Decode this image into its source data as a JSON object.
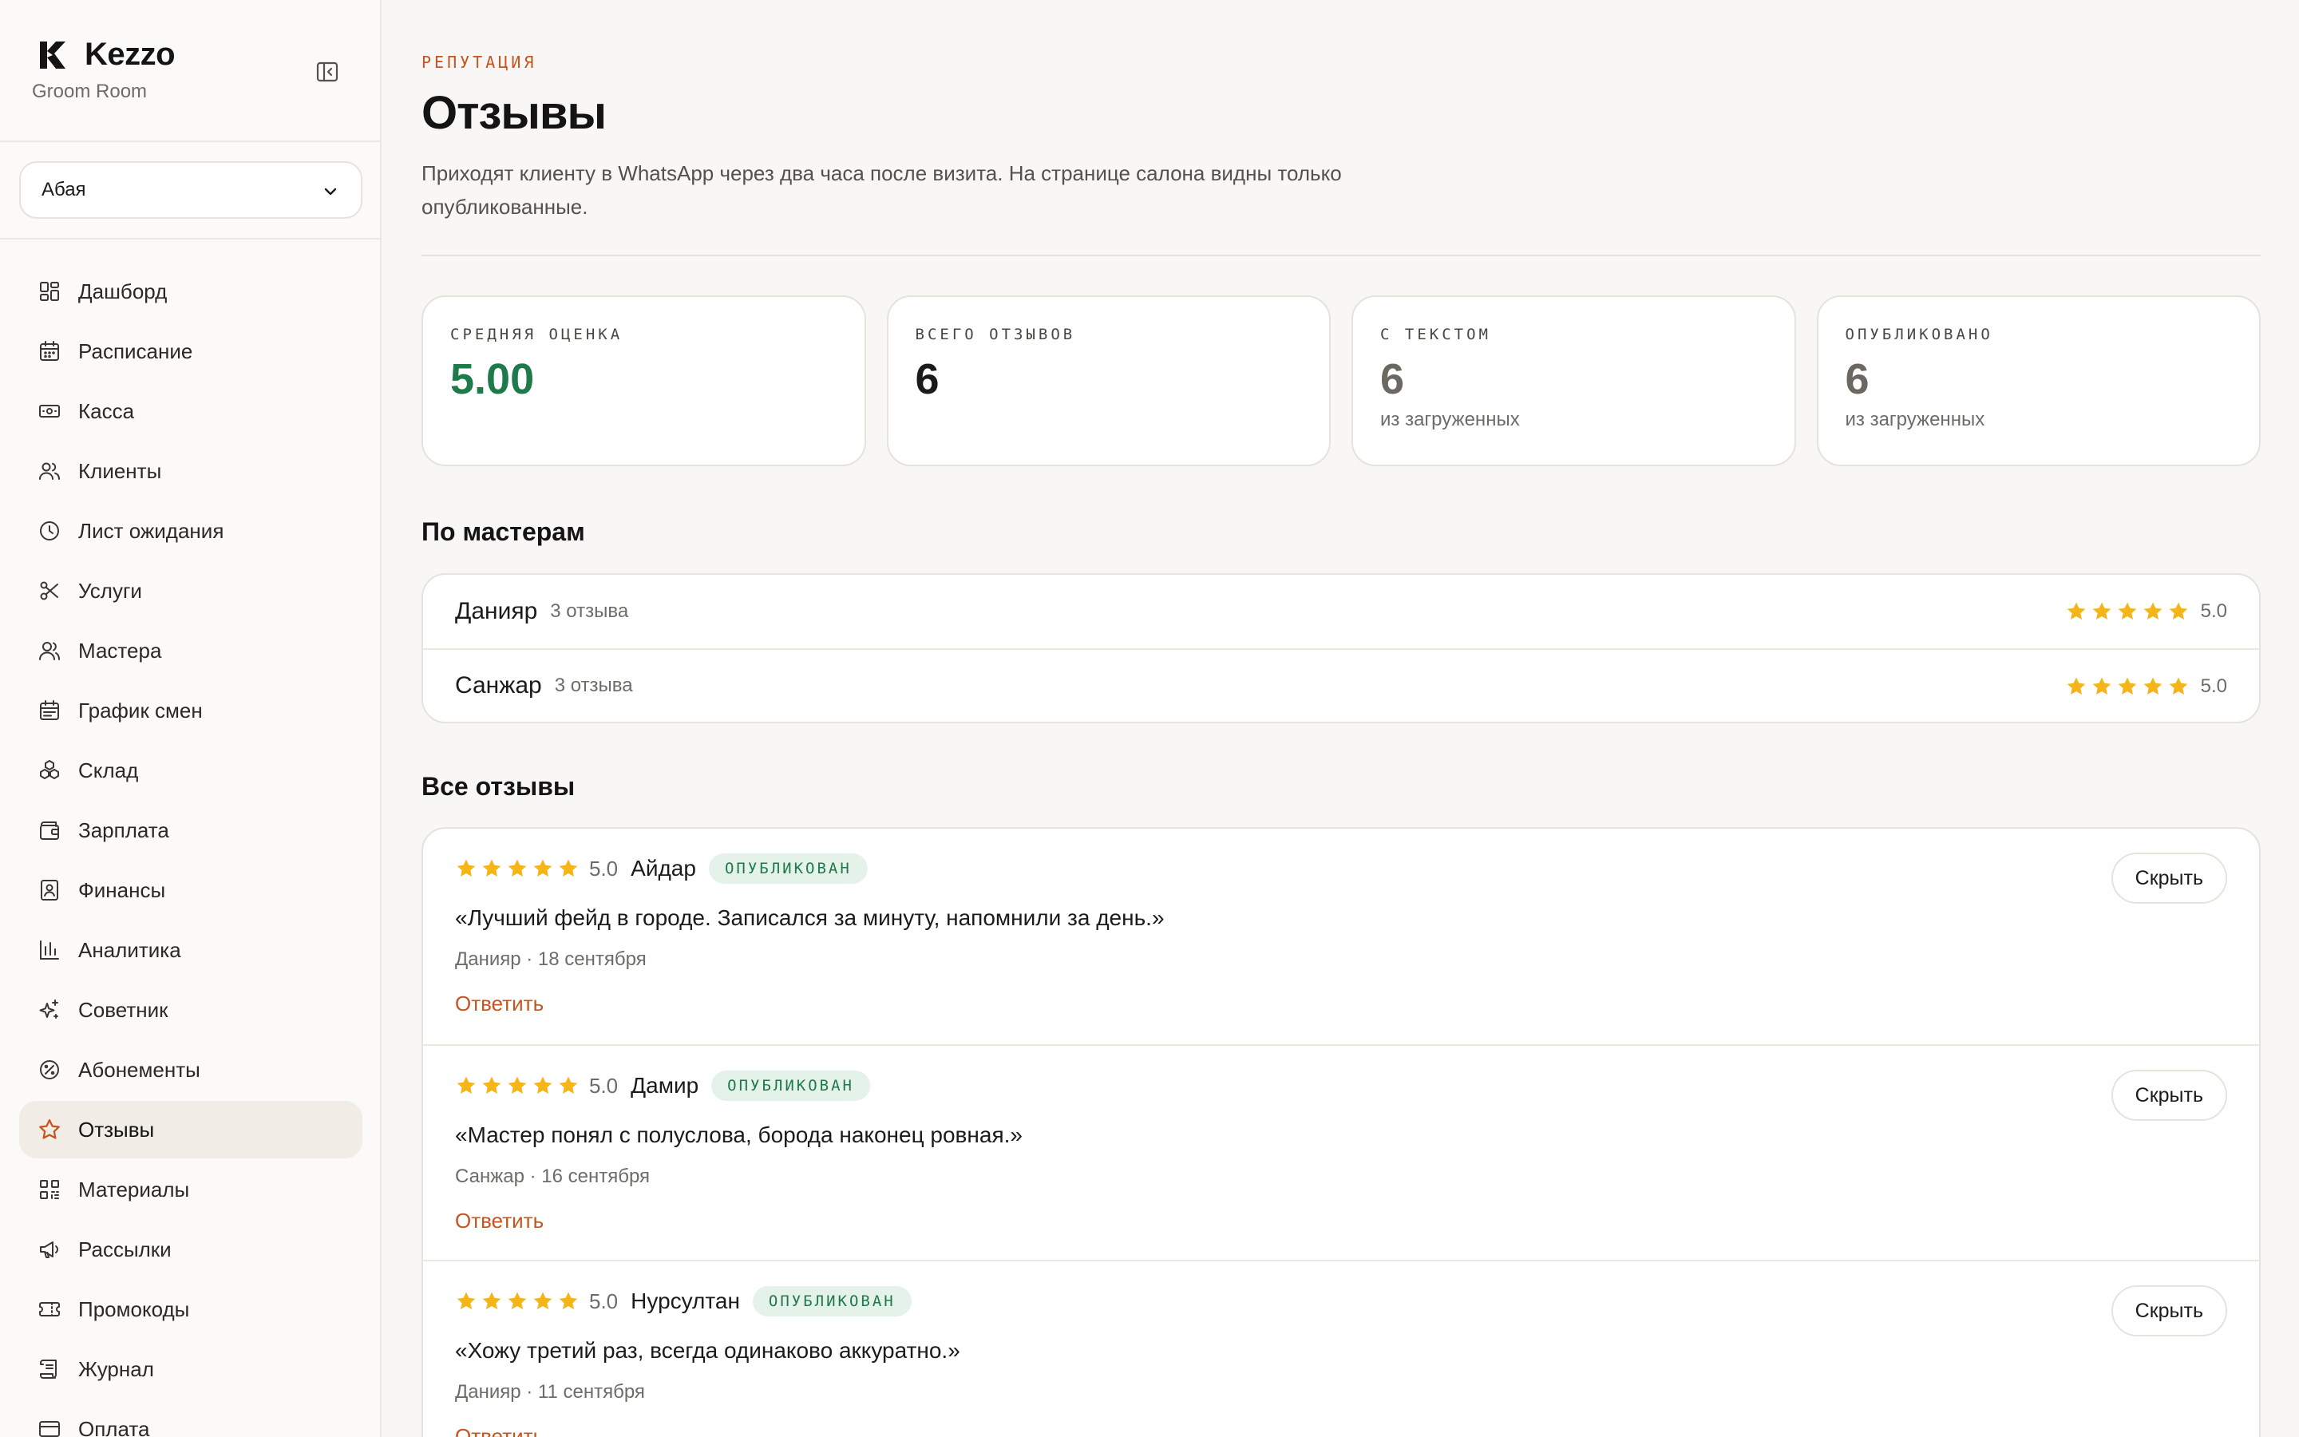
{
  "brand": {
    "name": "Kezzo",
    "subtitle": "Groom Room"
  },
  "branch": {
    "selected": "Абая"
  },
  "nav": [
    {
      "label": "Дашборд",
      "icon": "dashboard-icon"
    },
    {
      "label": "Расписание",
      "icon": "calendar-icon"
    },
    {
      "label": "Касса",
      "icon": "cash-icon"
    },
    {
      "label": "Клиенты",
      "icon": "users-icon"
    },
    {
      "label": "Лист ожидания",
      "icon": "clock-icon"
    },
    {
      "label": "Услуги",
      "icon": "scissors-icon"
    },
    {
      "label": "Мастера",
      "icon": "masters-icon"
    },
    {
      "label": "График смен",
      "icon": "shift-calendar-icon"
    },
    {
      "label": "Склад",
      "icon": "boxes-icon"
    },
    {
      "label": "Зарплата",
      "icon": "wallet-icon"
    },
    {
      "label": "Финансы",
      "icon": "finance-icon"
    },
    {
      "label": "Аналитика",
      "icon": "bar-chart-icon"
    },
    {
      "label": "Советник",
      "icon": "sparkles-icon"
    },
    {
      "label": "Абонементы",
      "icon": "percent-badge-icon"
    },
    {
      "label": "Отзывы",
      "icon": "star-icon",
      "active": true
    },
    {
      "label": "Материалы",
      "icon": "qr-icon"
    },
    {
      "label": "Рассылки",
      "icon": "megaphone-icon"
    },
    {
      "label": "Промокоды",
      "icon": "ticket-icon"
    },
    {
      "label": "Журнал",
      "icon": "scroll-icon"
    },
    {
      "label": "Оплата",
      "icon": "card-icon"
    }
  ],
  "page": {
    "eyebrow": "РЕПУТАЦИЯ",
    "title": "Отзывы",
    "description": "Приходят клиенту в WhatsApp через два часа после визита. На странице салона видны только опубликованные."
  },
  "stats": [
    {
      "label": "СРЕДНЯЯ ОЦЕНКА",
      "value": "5.00",
      "sub": ""
    },
    {
      "label": "ВСЕГО ОТЗЫВОВ",
      "value": "6",
      "sub": ""
    },
    {
      "label": "С ТЕКСТОМ",
      "value": "6",
      "sub": "из загруженных"
    },
    {
      "label": "ОПУБЛИКОВАНО",
      "value": "6",
      "sub": "из загруженных"
    }
  ],
  "masters_section": {
    "title": "По мастерам",
    "rows": [
      {
        "name": "Данияр",
        "count": "3 отзыва",
        "rating": "5.0",
        "stars": 5
      },
      {
        "name": "Санжар",
        "count": "3 отзыва",
        "rating": "5.0",
        "stars": 5
      }
    ]
  },
  "reviews_section": {
    "title": "Все отзывы",
    "items": [
      {
        "rating": "5.0",
        "stars": 5,
        "author": "Айдар",
        "status": "ОПУБЛИКОВАН",
        "text": "«Лучший фейд в городе. Записался за минуту, напомнили за день.»",
        "meta": "Данияр · 18 сентября",
        "reply": "Ответить",
        "hide": "Скрыть"
      },
      {
        "rating": "5.0",
        "stars": 5,
        "author": "Дамир",
        "status": "ОПУБЛИКОВАН",
        "text": "«Мастер понял с полуслова, борода наконец ровная.»",
        "meta": "Санжар · 16 сентября",
        "reply": "Ответить",
        "hide": "Скрыть"
      },
      {
        "rating": "5.0",
        "stars": 5,
        "author": "Нурсултан",
        "status": "ОПУБЛИКОВАН",
        "text": "«Хожу третий раз, всегда одинаково аккуратно.»",
        "meta": "Данияр · 11 сентября",
        "reply": "Ответить",
        "hide": "Скрыть"
      }
    ]
  },
  "colors": {
    "accent": "#c8531d",
    "success": "#1e7a4a",
    "star": "#f5b417"
  }
}
